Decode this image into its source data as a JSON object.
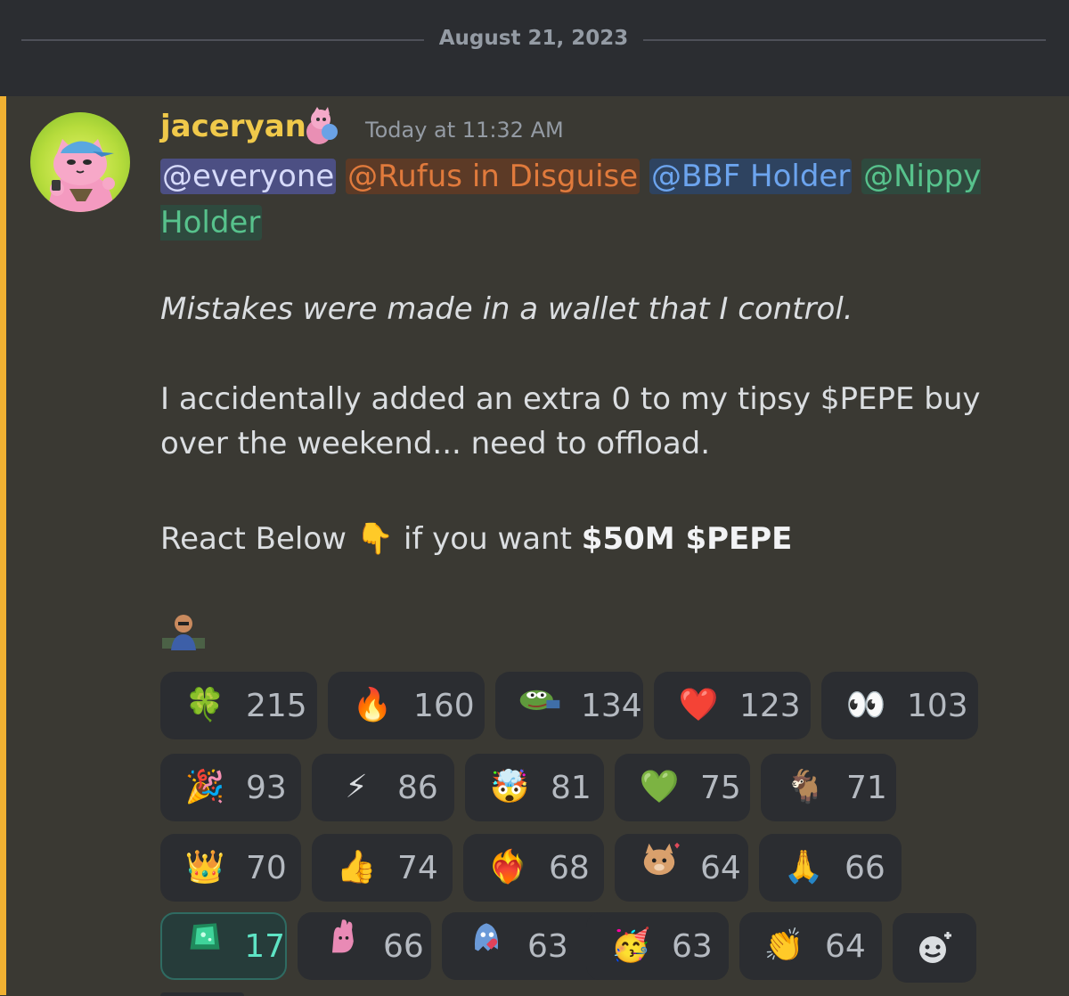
{
  "divider": {
    "date": "August 21, 2023"
  },
  "message": {
    "author": "jaceryan",
    "timestamp": "Today at 11:32 AM",
    "mentions": [
      "@everyone",
      "@Rufus in Disguise",
      "@BBF Holder",
      "@Nippy Holder"
    ],
    "line_italic": "Mistakes were made in a wallet that I control.",
    "line_body": "I accidentally added an extra 0 to my tipsy $PEPE buy over the weekend... need to offload.",
    "react_prefix": "React Below",
    "react_emoji": "👇",
    "react_middle": "if you want",
    "react_bold": "$50M $PEPE"
  },
  "reactions": [
    {
      "emoji": "🍀",
      "count": "215"
    },
    {
      "emoji": "🔥",
      "count": "160"
    },
    {
      "emoji": "pepe-custom-emoji",
      "count": "134"
    },
    {
      "emoji": "❤️",
      "count": "123"
    },
    {
      "emoji": "👀",
      "count": "103"
    },
    {
      "emoji": "🎉",
      "count": "93"
    },
    {
      "emoji": "⚡",
      "count": "86"
    },
    {
      "emoji": "🤯",
      "count": "81"
    },
    {
      "emoji": "💚",
      "count": "75"
    },
    {
      "emoji": "🐐",
      "count": "71"
    },
    {
      "emoji": "👑",
      "count": "70"
    },
    {
      "emoji": "👍",
      "count": "74"
    },
    {
      "emoji": "❤️‍🔥",
      "count": "68"
    },
    {
      "emoji": "cat-custom-emoji",
      "count": "64"
    },
    {
      "emoji": "🙏",
      "count": "66"
    },
    {
      "emoji": "gem-custom-emoji",
      "count": "17"
    },
    {
      "emoji": "hand-custom-emoji",
      "count": "66"
    },
    {
      "emoji": "ghost-custom-emoji",
      "count": "63"
    },
    {
      "emoji": "🥳",
      "count": "63"
    },
    {
      "emoji": "👏",
      "count": "64"
    }
  ],
  "colors": {
    "accent": "#f0b132",
    "username": "#f0c94a",
    "mention_everyone": "#4c4f83",
    "mention_rufus": "#e07a3c",
    "mention_bbf": "#6ca4ee",
    "mention_nippy": "#57c28c",
    "active_reaction": "#5ee3c4"
  }
}
